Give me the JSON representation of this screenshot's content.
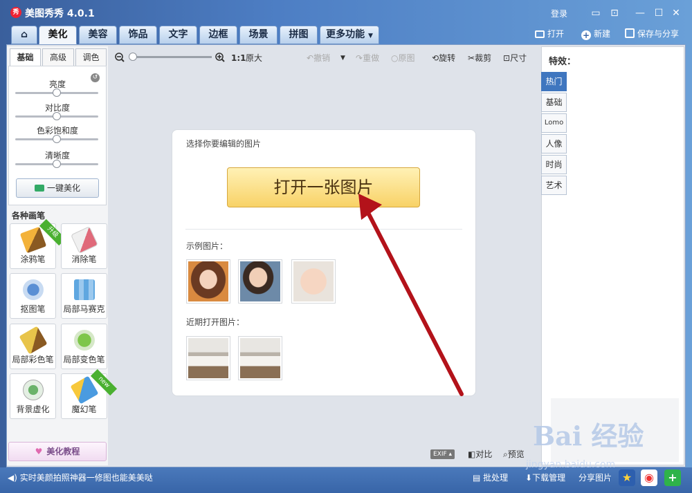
{
  "window": {
    "title": "美图秀秀 4.0.1",
    "logo_text": "秀",
    "login": "登录"
  },
  "tabs": [
    "美化",
    "美容",
    "饰品",
    "文字",
    "边框",
    "场景",
    "拼图",
    "更多功能"
  ],
  "header_actions": {
    "open": "打开",
    "new": "新建",
    "save_share": "保存与分享"
  },
  "left": {
    "tabs": [
      "基础",
      "高级",
      "调色"
    ],
    "sliders": [
      {
        "label": "亮度",
        "value": 0.5
      },
      {
        "label": "对比度",
        "value": 0.5
      },
      {
        "label": "色彩饱和度",
        "value": 0.5
      },
      {
        "label": "清晰度",
        "value": 0.5
      }
    ],
    "auto_button": "一键美化",
    "brushes_title": "各种画笔",
    "brushes": [
      {
        "label": "涂鸦笔",
        "badge": "升级"
      },
      {
        "label": "消除笔",
        "badge": ""
      },
      {
        "label": "抠图笔",
        "badge": ""
      },
      {
        "label": "局部马赛克",
        "badge": ""
      },
      {
        "label": "局部彩色笔",
        "badge": ""
      },
      {
        "label": "局部变色笔",
        "badge": ""
      },
      {
        "label": "背景虚化",
        "badge": ""
      },
      {
        "label": "魔幻笔",
        "badge": "new"
      }
    ],
    "tutorial": "美化教程"
  },
  "toolbar": {
    "zoom_ratio": "1:1",
    "original_size": "原大",
    "undo": "撤销",
    "redo": "重做",
    "original": "原图",
    "rotate": "旋转",
    "crop": "裁剪",
    "size": "尺寸",
    "zoom_level": 0.0
  },
  "canvas": {
    "select_prompt": "选择你要编辑的图片",
    "open_button": "打开一张图片",
    "samples_label": "示例图片：",
    "recent_label": "近期打开图片："
  },
  "bottom_tools": {
    "exif": "EXIF",
    "compare": "对比",
    "preview": "预览"
  },
  "right": {
    "title": "特效：",
    "tabs": [
      "热门",
      "基础",
      "Lomo",
      "人像",
      "时尚",
      "艺术"
    ]
  },
  "status": {
    "tip": "实时美颜拍照神器一修图也能美美哒",
    "batch": "批处理",
    "download": "下载管理",
    "share": "分享图片"
  },
  "watermark": {
    "brand": "Bai 经验",
    "url": "jingyan.baidu.com"
  },
  "colors": {
    "accent": "#3f76bf",
    "arrow": "#b3121a",
    "open_button": "#f8d267"
  }
}
